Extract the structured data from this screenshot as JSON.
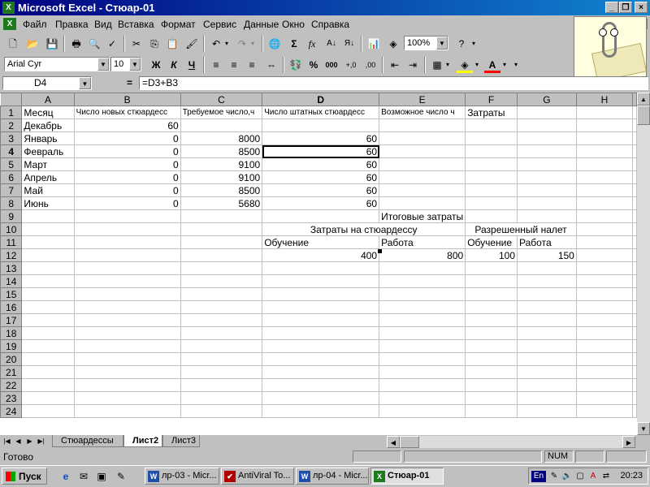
{
  "window": {
    "title": "Microsoft Excel - Стюар-01"
  },
  "menu": [
    "Файл",
    "Правка",
    "Вид",
    "Вставка",
    "Формат",
    "Сервис",
    "Данные",
    "Окно",
    "Справка"
  ],
  "toolbar": {
    "zoom": "100%",
    "font": "Arial Cyr",
    "size": "10"
  },
  "formula_bar": {
    "cell": "D4",
    "formula": "=D3+B3"
  },
  "grid": {
    "columns": [
      "A",
      "B",
      "C",
      "D",
      "E",
      "F",
      "G",
      "H"
    ],
    "rows": [
      [
        "Месяц",
        "Число новых стюардесс",
        "Требуемое число,ч",
        "Число штатных стюардесс",
        "Возможное число ч",
        "Затраты",
        "",
        ""
      ],
      [
        "Декабрь",
        "60",
        "",
        "",
        "",
        "",
        "",
        ""
      ],
      [
        "Январь",
        "0",
        "8000",
        "60",
        "",
        "",
        "",
        ""
      ],
      [
        "Февраль",
        "0",
        "8500",
        "60",
        "",
        "",
        "",
        ""
      ],
      [
        "Март",
        "0",
        "9100",
        "60",
        "",
        "",
        "",
        ""
      ],
      [
        "Апрель",
        "0",
        "9100",
        "60",
        "",
        "",
        "",
        ""
      ],
      [
        "Май",
        "0",
        "8500",
        "60",
        "",
        "",
        "",
        ""
      ],
      [
        "Июнь",
        "0",
        "5680",
        "60",
        "",
        "",
        "",
        ""
      ],
      [
        "",
        "",
        "",
        "",
        "Итоговые затраты",
        "",
        "",
        ""
      ],
      [
        "",
        "",
        "",
        "Затраты на стюардессу",
        "",
        "Разрешенный налет",
        "",
        ""
      ],
      [
        "",
        "",
        "",
        "Обучение",
        "Работа",
        "Обучение",
        "Работа",
        ""
      ],
      [
        "",
        "",
        "",
        "400",
        "800",
        "100",
        "150",
        ""
      ],
      [
        "",
        "",
        "",
        "",
        "",
        "",
        "",
        ""
      ],
      [
        "",
        "",
        "",
        "",
        "",
        "",
        "",
        ""
      ],
      [
        "",
        "",
        "",
        "",
        "",
        "",
        "",
        ""
      ],
      [
        "",
        "",
        "",
        "",
        "",
        "",
        "",
        ""
      ],
      [
        "",
        "",
        "",
        "",
        "",
        "",
        "",
        ""
      ],
      [
        "",
        "",
        "",
        "",
        "",
        "",
        "",
        ""
      ],
      [
        "",
        "",
        "",
        "",
        "",
        "",
        "",
        ""
      ],
      [
        "",
        "",
        "",
        "",
        "",
        "",
        "",
        ""
      ],
      [
        "",
        "",
        "",
        "",
        "",
        "",
        "",
        ""
      ],
      [
        "",
        "",
        "",
        "",
        "",
        "",
        "",
        ""
      ],
      [
        "",
        "",
        "",
        "",
        "",
        "",
        "",
        ""
      ],
      [
        "",
        "",
        "",
        "",
        "",
        "",
        "",
        ""
      ]
    ]
  },
  "sheets": [
    "Стюардессы",
    "Лист2",
    "Лист3"
  ],
  "active_sheet": "Лист2",
  "status": {
    "text": "Готово",
    "num": "NUM"
  },
  "taskbar": {
    "start": "Пуск",
    "tasks": [
      "лр-03 - Micr...",
      "AntiViral To...",
      "лр-04 - Micr...",
      "Стюар-01"
    ],
    "active_task": "Стюар-01",
    "lang": "En",
    "clock": "20:23"
  }
}
